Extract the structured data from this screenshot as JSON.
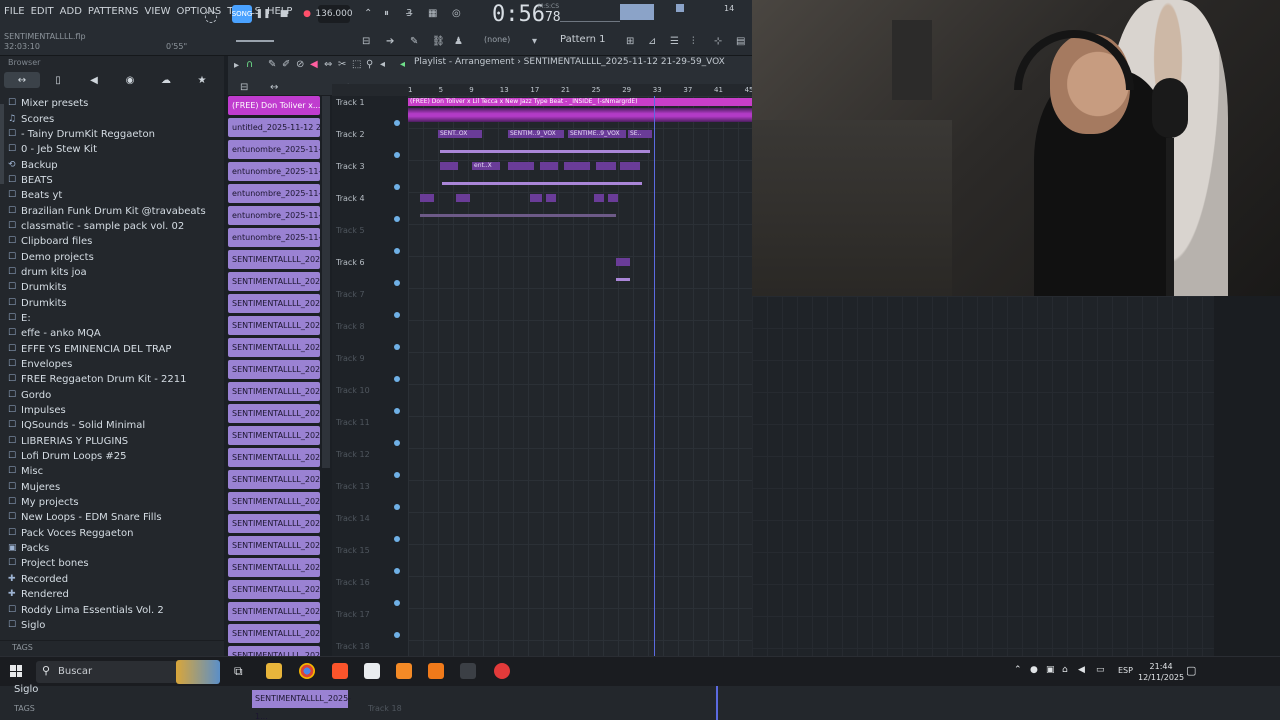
{
  "menu": [
    "FILE",
    "EDIT",
    "ADD",
    "PATTERNS",
    "VIEW",
    "OPTIONS",
    "TOOLS",
    "HELP"
  ],
  "hint": {
    "file": "SENTIMENTALLLL.flp",
    "time": "32:03:10",
    "duration": "0'55\""
  },
  "transport": {
    "song_label": "SONG",
    "bpm": "136.000",
    "timecode": "0:56",
    "timecode_frac": "78",
    "mcs": "M:S:CS",
    "pattern": "Pattern 1",
    "snap": "(none)",
    "cpu": "14"
  },
  "browser": {
    "title": "Browser",
    "items": [
      {
        "label": "Mixer presets",
        "icon": "folder-icon"
      },
      {
        "label": "Scores",
        "icon": "music-icon"
      },
      {
        "label": "- Tainy DrumKit Reggaeton",
        "icon": "folder-icon"
      },
      {
        "label": "0 - Jeb Stew Kit",
        "icon": "folder-icon"
      },
      {
        "label": "Backup",
        "icon": "backup-icon"
      },
      {
        "label": "BEATS",
        "icon": "folder-icon"
      },
      {
        "label": "Beats yt",
        "icon": "folder-icon"
      },
      {
        "label": "Brazilian Funk Drum Kit @travabeats",
        "icon": "folder-icon"
      },
      {
        "label": "classmatic - sample pack vol. 02",
        "icon": "folder-icon"
      },
      {
        "label": "Clipboard files",
        "icon": "folder-icon"
      },
      {
        "label": "Demo projects",
        "icon": "folder-icon"
      },
      {
        "label": "drum kits joa",
        "icon": "folder-icon"
      },
      {
        "label": "Drumkits",
        "icon": "folder-icon"
      },
      {
        "label": "Drumkits",
        "icon": "folder-icon"
      },
      {
        "label": "E:",
        "icon": "folder-icon"
      },
      {
        "label": "effe - anko MQA",
        "icon": "folder-icon"
      },
      {
        "label": "EFFE YS EMINENCIA DEL TRAP",
        "icon": "folder-icon"
      },
      {
        "label": "Envelopes",
        "icon": "folder-icon"
      },
      {
        "label": "FREE Reggaeton Drum Kit - 2211",
        "icon": "folder-icon"
      },
      {
        "label": "Gordo",
        "icon": "folder-icon"
      },
      {
        "label": "Impulses",
        "icon": "folder-icon"
      },
      {
        "label": "IQSounds - Solid Minimal",
        "icon": "folder-icon"
      },
      {
        "label": "LIBRERIAS Y PLUGINS",
        "icon": "folder-icon"
      },
      {
        "label": "Lofi Drum Loops #25",
        "icon": "folder-icon"
      },
      {
        "label": "Misc",
        "icon": "folder-icon"
      },
      {
        "label": "Mujeres",
        "icon": "folder-icon"
      },
      {
        "label": "My projects",
        "icon": "folder-icon"
      },
      {
        "label": "New Loops - EDM Snare Fills",
        "icon": "folder-icon"
      },
      {
        "label": "Pack Voces Reggaeton",
        "icon": "folder-icon"
      },
      {
        "label": "Packs",
        "icon": "packs-icon"
      },
      {
        "label": "Project bones",
        "icon": "folder-icon"
      },
      {
        "label": "Recorded",
        "icon": "plus-icon"
      },
      {
        "label": "Rendered",
        "icon": "plus-icon"
      },
      {
        "label": "Roddy Lima Essentials Vol. 2",
        "icon": "folder-icon"
      },
      {
        "label": "Siglo",
        "icon": "folder-icon"
      }
    ],
    "tags_label": "TAGS"
  },
  "playlist": {
    "title": "Playlist - Arrangement › SENTIMENTALLLL_2025-11-12 21-29-59_VOX",
    "ruler": [
      "1",
      "5",
      "9",
      "13",
      "17",
      "21",
      "25",
      "29",
      "33",
      "37",
      "41",
      "45"
    ],
    "tracks": [
      "Track 1",
      "Track 2",
      "Track 3",
      "Track 4",
      "Track 5",
      "Track 6",
      "Track 7",
      "Track 8",
      "Track 9",
      "Track 10",
      "Track 11",
      "Track 12",
      "Track 13",
      "Track 14",
      "Track 15",
      "Track 16",
      "Track 17",
      "Track 18"
    ],
    "clip1": "(FREE) Don Toliver x Lil Tecca x New Jazz Type Beat - _INSIDE_ (-sNmargrdE)",
    "clip_labels": [
      "SENT..OX",
      "SENTIM..9_VOX",
      "SENTIME..9_VOX",
      "SE..",
      "ent..X"
    ]
  },
  "patterns": [
    "(FREE) Don Toliver x...",
    "untitled_2025-11-12 20-...",
    "entunombre_2025-11-12...",
    "entunombre_2025-11-12...",
    "entunombre_2025-11-12...",
    "entunombre_2025-11-12...",
    "entunombre_2025-11-12...",
    "SENTIMENTALLLL_2025-1...",
    "SENTIMENTALLLL_2025-1...",
    "SENTIMENTALLLL_2025-1...",
    "SENTIMENTALLLL_2025-1...",
    "SENTIMENTALLLL_2025-1...",
    "SENTIMENTALLLL_2025-1...",
    "SENTIMENTALLLL_2025-1...",
    "SENTIMENTALLLL_2025-1...",
    "SENTIMENTALLLL_2025-1...",
    "SENTIMENTALLLL_2025-1...",
    "SENTIMENTALLLL_2025-1...",
    "SENTIMENTALLLL_2025-1...",
    "SENTIMENTALLLL_2025-1...",
    "SENTIMENTALLLL_2025-1...",
    "SENTIMENTALLLL_2025-1...",
    "SENTIMENTALLLL_2025-1...",
    "SENTIMENTALLLL_2025-1...",
    "SENTIMENTALLLL_2025-1...",
    "SENTIMENTALLLL_2025-1..."
  ],
  "taskbar": {
    "search": "Buscar",
    "lang": "ESP",
    "time": "21:44",
    "date": "12/11/2025"
  },
  "bottom": {
    "siglo": "Siglo",
    "tags": "TAGS",
    "pattern": "SENTIMENTALLLL_2025-1...",
    "track": "Track 18"
  }
}
